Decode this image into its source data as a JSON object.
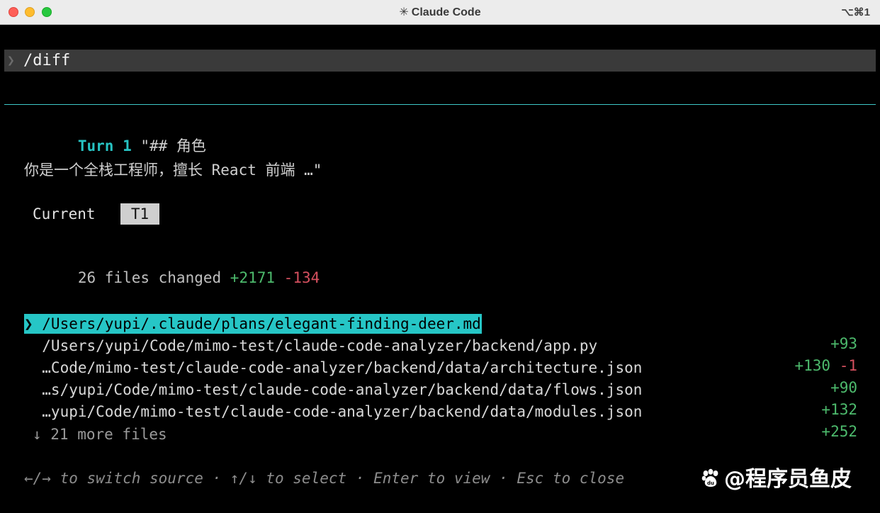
{
  "window": {
    "title": "Claude Code",
    "title_icon": "✳",
    "shortcut": "⌥⌘1"
  },
  "prompt": {
    "chevron": "❯",
    "text": "/diff"
  },
  "turn": {
    "label": "Turn 1",
    "title_text": " \"## 角色",
    "body": "你是一个全栈工程师，擅长 React 前端 …\""
  },
  "tabs": {
    "current": "Current",
    "t1": "T1"
  },
  "summary": {
    "prefix": "26 files changed ",
    "additions": "+2171",
    "deletions": "-134"
  },
  "files": [
    {
      "path": "❯ /Users/yupi/.claude/plans/elegant-finding-deer.md",
      "additions": "+93",
      "deletions": "",
      "selected": true
    },
    {
      "path": "  /Users/yupi/Code/mimo-test/claude-code-analyzer/backend/app.py",
      "additions": "+130",
      "deletions": "-1",
      "selected": false
    },
    {
      "path": "  …Code/mimo-test/claude-code-analyzer/backend/data/architecture.json",
      "additions": "+90",
      "deletions": "",
      "selected": false
    },
    {
      "path": "  …s/yupi/Code/mimo-test/claude-code-analyzer/backend/data/flows.json",
      "additions": "+132",
      "deletions": "",
      "selected": false
    },
    {
      "path": "  …yupi/Code/mimo-test/claude-code-analyzer/backend/data/modules.json",
      "additions": "+252",
      "deletions": "",
      "selected": false
    }
  ],
  "more_files": "↓ 21 more files",
  "help": "←/→ to switch source · ↑/↓ to select · Enter to view · Esc to close",
  "watermark": {
    "text": "@程序员鱼皮",
    "logo_icon": "baidu-paw-icon"
  },
  "colors": {
    "accent": "#26c6c6",
    "addition": "#4dbb6d",
    "deletion": "#d5505f",
    "background": "#000000"
  }
}
